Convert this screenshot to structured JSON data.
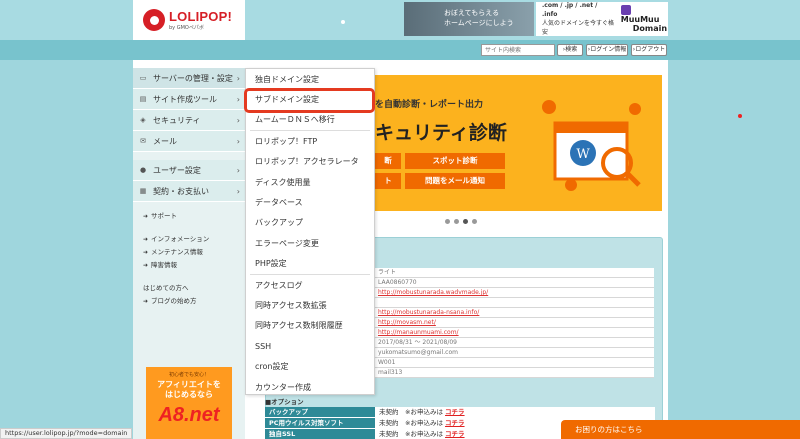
{
  "header": {
    "logo_name": "LOLIPOP!",
    "logo_sub": "by GMOペパボ",
    "ad1_line1": "おぼえてもらえる",
    "ad1_line2": "ホームページにしよう",
    "ad2_domains": ".com / .jp / .net / .info",
    "ad2_tagline": "人気のドメインを今すぐ格安",
    "ad2_brand1": "MuuMuu",
    "ad2_brand2": "Domain"
  },
  "search": {
    "placeholder": "サイト内検索",
    "search_button": "›検索",
    "login_info_button": "›ログイン情報",
    "logout_button": "›ログアウト"
  },
  "sidebar": {
    "items": [
      {
        "label": "サーバーの管理・設定",
        "icon": "server-icon"
      },
      {
        "label": "サイト作成ツール",
        "icon": "tools-icon"
      },
      {
        "label": "セキュリティ",
        "icon": "shield-icon"
      },
      {
        "label": "メール",
        "icon": "mail-icon"
      },
      {
        "label": "ユーザー設定",
        "icon": "user-icon"
      },
      {
        "label": "契約・お支払い",
        "icon": "billing-icon"
      }
    ],
    "support": "サポート",
    "info_links": [
      "インフォメーション",
      "メンテナンス情報",
      "障害情報"
    ],
    "beginner": "はじめての方へ",
    "blog": "ブログの始め方"
  },
  "a8": {
    "small": "初心者でも安心！",
    "line1": "アフィリエイトを",
    "line2": "はじめるなら",
    "logo": "A8.net"
  },
  "promo": {
    "line1": "を自動診断・レポート出力",
    "line2": "キュリティ診断",
    "btn1": "断",
    "btn2": "スポット診断",
    "btn3": "ト",
    "btn4": "問題をメール通知"
  },
  "dropdown": {
    "items": [
      "独自ドメイン設定",
      "サブドメイン設定",
      "ムームーＤＮＳへ移行",
      "ロリポップ！FTP",
      "ロリポップ！アクセラレータ",
      "ディスク使用量",
      "データベース",
      "バックアップ",
      "エラーページ変更",
      "PHP設定",
      "アクセスログ",
      "同時アクセス数拡張",
      "同時アクセス数制限履歴",
      "SSH",
      "cron設定",
      "カウンター作成"
    ]
  },
  "info_rows": [
    {
      "text": "ライト",
      "link": false
    },
    {
      "text": "LAA0860770",
      "link": false
    },
    {
      "text": "http://mobustunarada.wadvmade.jp/",
      "link": true
    },
    {
      "text": "",
      "link": false
    },
    {
      "text": "http://mobustunarada-nsana.info/",
      "link": true
    },
    {
      "text": "http://movasm.net/",
      "link": true
    },
    {
      "text": "http://manaunmuami.com/",
      "link": true
    },
    {
      "text": "2017/08/31 〜 2021/08/09",
      "link": false
    },
    {
      "text": "yukomatsumo@gmail.com",
      "link": false
    },
    {
      "text": "W001",
      "link": false
    },
    {
      "text": "mail313",
      "link": false
    }
  ],
  "options": {
    "heading": "■オプション",
    "rows": [
      {
        "key": "バックアップ",
        "status": "未契約",
        "note": "※お申込みは",
        "link": "コチラ"
      },
      {
        "key": "PC用ウイルス対策ソフト",
        "status": "未契約",
        "note": "※お申込みは",
        "link": "コチラ"
      },
      {
        "key": "独自SSL",
        "status": "未契約",
        "note": "※お申込みは",
        "link": "コチラ"
      }
    ]
  },
  "statusbar": "https://user.lolipop.jp/?mode=domain",
  "help_tab": "お困りの方はこちら"
}
